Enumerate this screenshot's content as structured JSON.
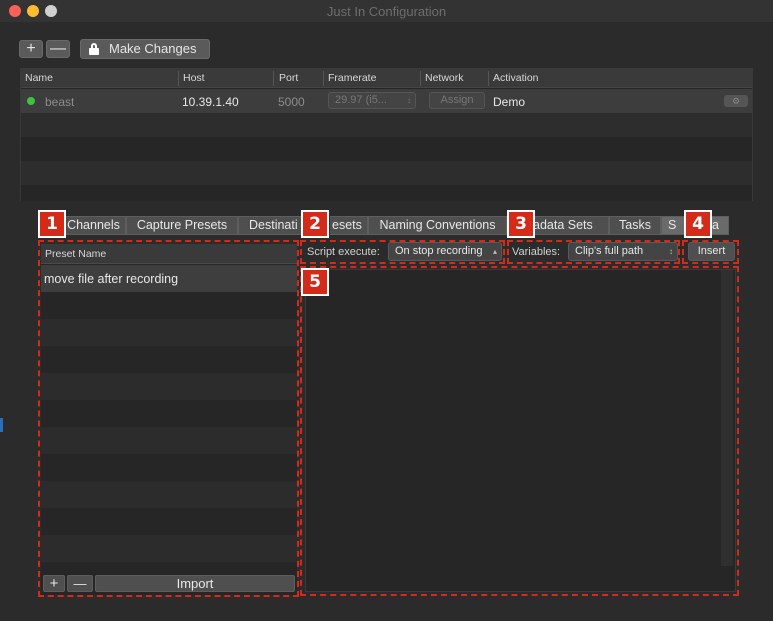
{
  "window": {
    "title": "Just In Configuration"
  },
  "toolbar": {
    "add_label": "+",
    "remove_label": "—",
    "make_changes_label": "Make Changes"
  },
  "sources_table": {
    "columns": [
      "Name",
      "Host",
      "Port",
      "Framerate",
      "Network",
      "Activation"
    ],
    "rows": [
      {
        "name": "beast",
        "host": "10.39.1.40",
        "port": "5000",
        "framerate": "29.97 (i5...",
        "network_button": "Assign",
        "activation": "Demo",
        "status_color": "#3cc43c"
      }
    ]
  },
  "tabs": [
    "Channels",
    "Capture Presets",
    "Destinations",
    "Presets",
    "Naming Conventions",
    "Metadata Sets",
    "Tasks",
    "Scripts"
  ],
  "tabs_visible": {
    "t0": "Channels",
    "t1": "Capture Presets",
    "t2": "Destinati",
    "t3": "esets",
    "t4": "Naming Conventions",
    "t5": "adata Sets",
    "t6": "Tasks",
    "t7": "S",
    "t7b": "a"
  },
  "preset_list": {
    "header": "Preset Name",
    "items": [
      "move file after recording"
    ],
    "add_label": "+",
    "remove_label": "—",
    "import_label": "Import"
  },
  "script_bar": {
    "execute_label": "Script execute:",
    "execute_value": "On stop recording",
    "variables_label": "Variables:",
    "variables_value": "Clip's full path",
    "insert_label": "Insert"
  },
  "callouts": [
    "1",
    "2",
    "3",
    "4",
    "5"
  ],
  "colors": {
    "callout": "#d42a1a",
    "status_green": "#3cc43c",
    "background": "#2b2b2b"
  }
}
